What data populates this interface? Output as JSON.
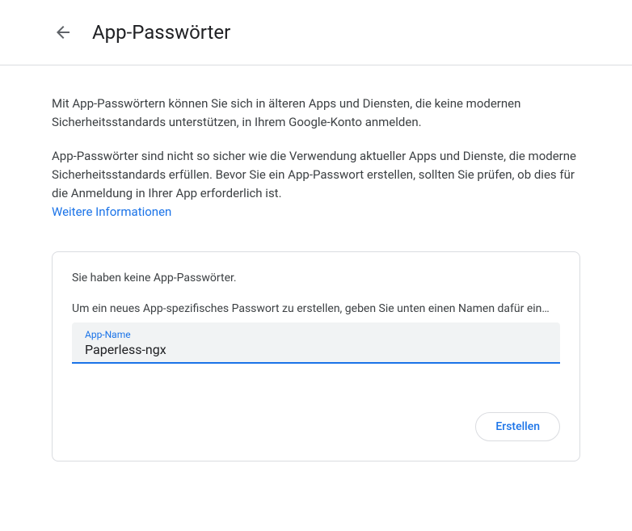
{
  "header": {
    "title": "App-Passwörter"
  },
  "description": "Mit App-Passwörtern können Sie sich in älteren Apps und Diensten, die keine modernen Sicherheitsstandards unterstützen, in Ihrem Google-Konto anmelden.",
  "warning": {
    "text": "App-Passwörter sind nicht so sicher wie die Verwendung aktueller Apps und Dienste, die moderne Sicherheitsstandards erfüllen. Bevor Sie ein App-Passwort erstellen, sollten Sie prüfen, ob dies für die Anmeldung in Ihrer App erforderlich ist.",
    "learn_more": "Weitere Informationen"
  },
  "card": {
    "status": "Sie haben keine App-Passwörter.",
    "instruction": "Um ein neues App-spezifisches Passwort zu erstellen, geben Sie unten einen Namen dafür ein…",
    "input_label": "App-Name",
    "input_value": "Paperless-ngx",
    "create_button": "Erstellen"
  },
  "colors": {
    "primary": "#1a73e8",
    "border": "#dadce0",
    "text": "#202124",
    "text_secondary": "#3c4043",
    "icon": "#5f6368",
    "input_bg": "#f1f3f4"
  }
}
